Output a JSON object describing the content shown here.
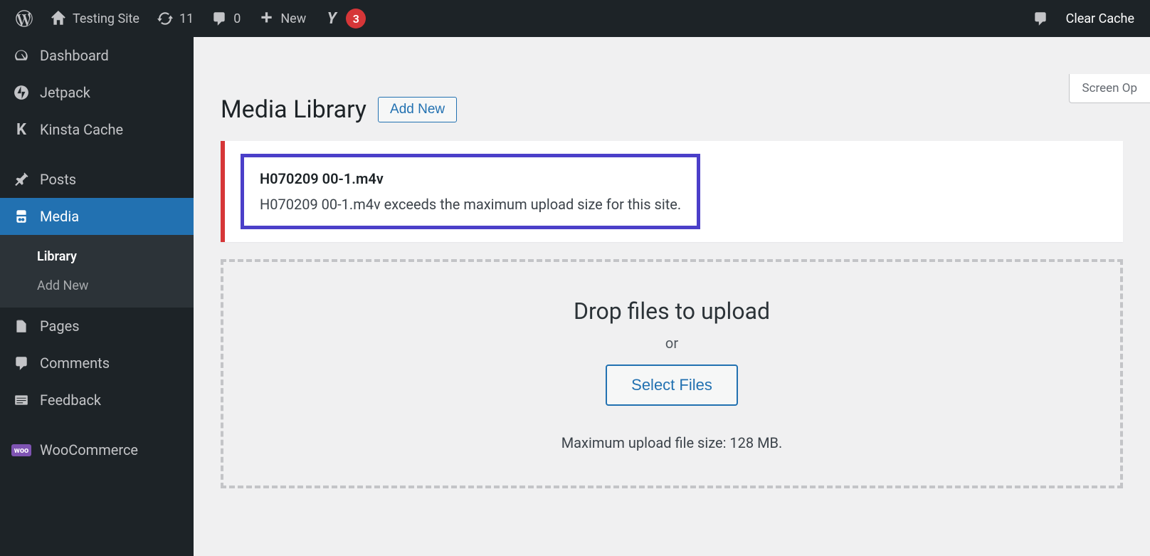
{
  "adminbar": {
    "site_name": "Testing Site",
    "updates_count": "11",
    "comments_count": "0",
    "new_label": "New",
    "yoast_badge": "3",
    "clear_cache": "Clear Cache"
  },
  "sidebar": {
    "items": [
      {
        "label": "Dashboard"
      },
      {
        "label": "Jetpack"
      },
      {
        "label": "Kinsta Cache"
      },
      {
        "label": "Posts"
      },
      {
        "label": "Media"
      },
      {
        "label": "Pages"
      },
      {
        "label": "Comments"
      },
      {
        "label": "Feedback"
      },
      {
        "label": "WooCommerce"
      }
    ],
    "media_submenu": {
      "library": "Library",
      "add_new": "Add New"
    }
  },
  "main": {
    "screen_options": "Screen Op",
    "title": "Media Library",
    "add_new_btn": "Add New",
    "error": {
      "filename": "H070209 00-1.m4v",
      "message": "H070209 00-1.m4v exceeds the maximum upload size for this site."
    },
    "uploader": {
      "drop_title": "Drop files to upload",
      "or": "or",
      "select_files": "Select Files",
      "max_size": "Maximum upload file size: 128 MB."
    }
  }
}
